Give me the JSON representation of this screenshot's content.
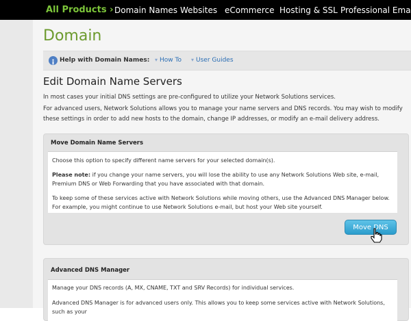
{
  "nav": {
    "all_products": "All Products ›",
    "items": [
      "Domain Names",
      "Websites",
      "eCommerce",
      "Hosting & SSL",
      "Professional Email"
    ]
  },
  "page": {
    "title": "Domain"
  },
  "help": {
    "label": "Help with Domain Names:",
    "how_to": "How To",
    "user_guides": "User Guides"
  },
  "section": {
    "title": "Edit Domain Name Servers",
    "para1": "In most cases your initial DNS settings are pre-configured to utilize your Network Solutions services.",
    "para2": "For advanced users, Network Solutions allows you to manage your name servers and DNS records. You may wish to modify these settings in order to add new hosts to the domain, change IP addresses, or modify an e-mail delivery address."
  },
  "move_panel": {
    "heading": "Move Domain Name Servers",
    "text1": "Choose this option to specify different name servers for your selected domain(s).",
    "note_label": "Please note:",
    "note_text": " if you change your name servers, you will lose the ability to use any Network Solutions Web site, e-mail, Premium DNS or Web Forwarding that you have associated with that domain.",
    "text3": "To keep some of these services active with Network Solutions while moving others, use the Advanced DNS Manager below. For example, you might continue to use Network Solutions e-mail, but host your Web site yourself.",
    "button": "Move DNS"
  },
  "advanced_panel": {
    "heading": "Advanced DNS Manager",
    "text1": "Manage your DNS records (A, MX, CNAME, TXT and SRV Records) for individual services.",
    "text2": "Advanced DNS Manager is for advanced users only. This allows you to keep some services active with Network Solutions, such as your"
  },
  "colors": {
    "brand_green": "#6c9a2e",
    "nav_green": "#7cc53a",
    "link_blue": "#2a6db4",
    "button_blue": "#2b9ccc"
  }
}
